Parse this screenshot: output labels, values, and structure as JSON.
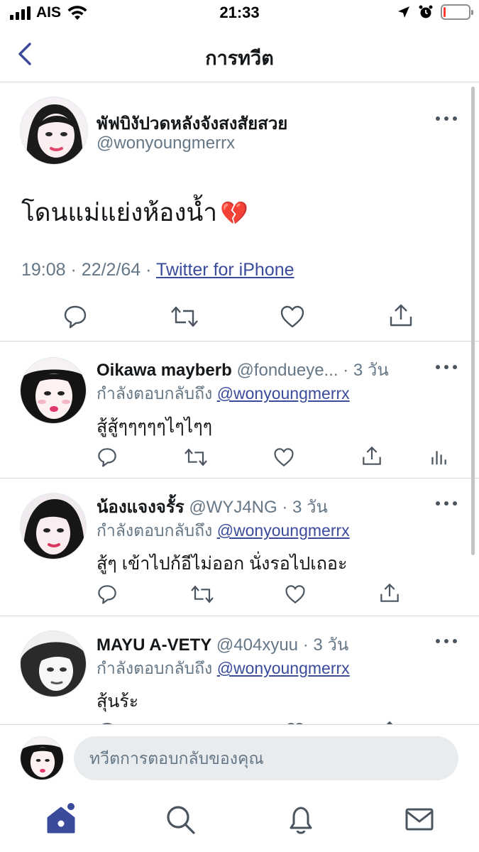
{
  "status_bar": {
    "carrier": "AIS",
    "time": "21:33",
    "battery_level": 0.1
  },
  "header": {
    "title": "การทวีต",
    "back_icon": "chevron-left-icon"
  },
  "main_tweet": {
    "display_name": "พัฟบิงัปวดหลังจังสงสัยสวย",
    "handle": "@wonyoungmerrx",
    "text": "โดนแม่แย่งห้องน้ำ",
    "emoji": "💔",
    "time": "19:08",
    "date": "22/2/64",
    "separator": "·",
    "source": "Twitter for iPhone"
  },
  "replies": [
    {
      "display_name": "Oikawa mayberb",
      "handle": "@fondueye...",
      "time_ago": "· 3 วัน",
      "replying_label": "กำลังตอบกลับถึง",
      "replying_to": "@wonyoungmerrx",
      "text": "สู้สู้ๆๆๆๆๆไๆไๆๆ"
    },
    {
      "display_name": "น้องแจงจรั้ร",
      "handle": "@WYJ4NG",
      "time_ago": "· 3 วัน",
      "replying_label": "กำลังตอบกลับถึง",
      "replying_to": "@wonyoungmerrx",
      "text": "สู้ๆ เข้าไปก้อีไม่ออก นั่งรอไปเถอะ"
    },
    {
      "display_name": "MAYU A-VETY",
      "handle": "@404xyuu",
      "time_ago": "· 3 วัน",
      "replying_label": "กำลังตอบกลับถึง",
      "replying_to": "@wonyoungmerrx",
      "text": "สุ้นร้ะ"
    }
  ],
  "composer": {
    "placeholder": "ทวีตการตอบกลับของคุณ"
  },
  "tabbar": {
    "items": [
      "home-icon",
      "search-icon",
      "notifications-icon",
      "messages-icon"
    ]
  },
  "colors": {
    "accent": "#3b4b9b",
    "text": "#14171a",
    "muted": "#657786",
    "divider": "#d6d9db",
    "battery_low": "#ff3b30"
  }
}
